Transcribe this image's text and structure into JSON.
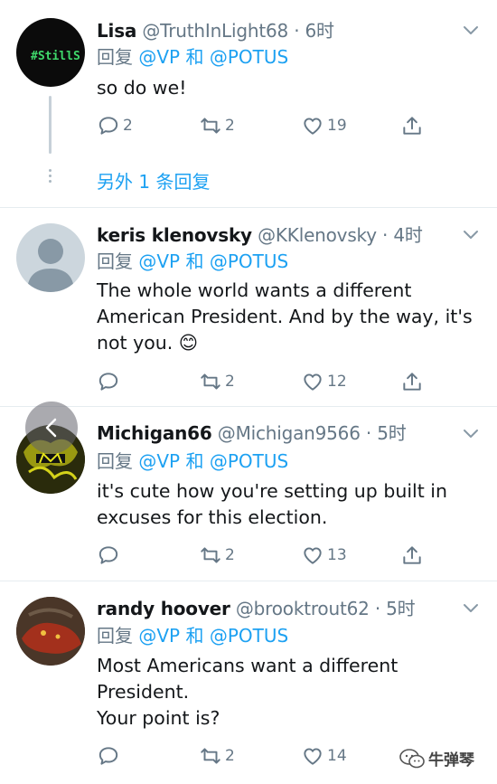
{
  "tweets": [
    {
      "display_name": "Lisa",
      "handle": "@TruthInLight68",
      "separator": "·",
      "time": "6时",
      "reply_prefix": "回复",
      "mention1": "@VP",
      "conj": "和",
      "mention2": "@POTUS",
      "text": "so do we!",
      "replies": "2",
      "retweets": "2",
      "likes": "19",
      "avatar_text": "#StillS"
    },
    {
      "display_name": "keris klenovsky",
      "handle": "@KKlenovsky",
      "separator": "·",
      "time": "4时",
      "reply_prefix": "回复",
      "mention1": "@VP",
      "conj": "和",
      "mention2": "@POTUS",
      "text": "The whole world wants a different American President. And by the way, it's not you. 😊",
      "replies": "",
      "retweets": "2",
      "likes": "12"
    },
    {
      "display_name": "Michigan66",
      "handle": "@Michigan9566",
      "separator": "·",
      "time": "5时",
      "reply_prefix": "回复",
      "mention1": "@VP",
      "conj": "和",
      "mention2": "@POTUS",
      "text": "it's cute how you're setting up built in excuses for this election.",
      "replies": "",
      "retweets": "2",
      "likes": "13"
    },
    {
      "display_name": "randy hoover",
      "handle": "@brooktrout62",
      "separator": "·",
      "time": "5时",
      "reply_prefix": "回复",
      "mention1": "@VP",
      "conj": "和",
      "mention2": "@POTUS",
      "text_lines": [
        "Most Americans want a different",
        "President.",
        "Your point is?"
      ],
      "replies": "",
      "retweets": "2",
      "likes": "14"
    }
  ],
  "more_replies_label": "另外 1 条回复",
  "watermark_label": "牛弹琴",
  "icons": [
    "reply-icon",
    "retweet-icon",
    "like-icon",
    "share-icon",
    "chevron-down-icon",
    "back-arrow-icon"
  ]
}
